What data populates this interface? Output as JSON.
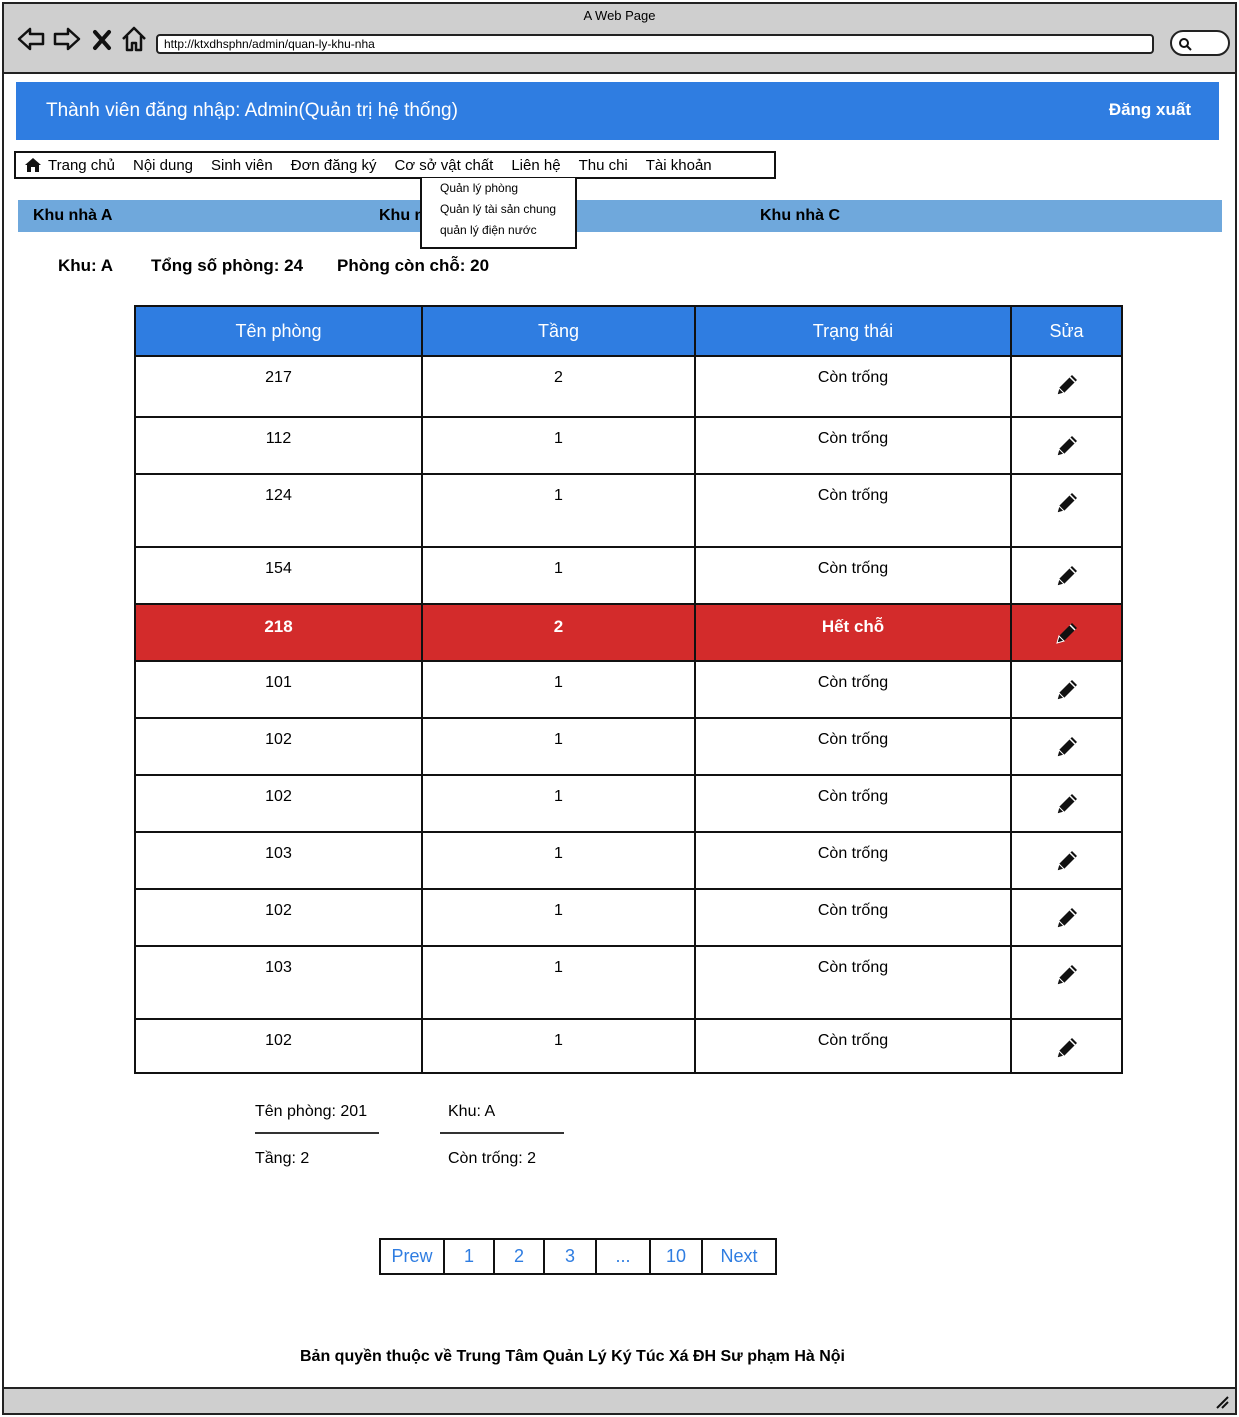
{
  "browser": {
    "window_title": "A Web Page",
    "url": "http://ktxdhsphn/admin/quan-ly-khu-nha"
  },
  "header": {
    "title": "Thành viên đăng nhập: Admin(Quản trị hệ thống)",
    "logout_label": "Đăng xuất"
  },
  "menu": {
    "items": [
      "Trang chủ",
      "Nội dung",
      "Sinh viên",
      "Đơn đăng ký",
      "Cơ sở vật chất",
      "Liên hệ",
      "Thu chi",
      "Tài khoản"
    ],
    "dropdown": [
      "Quản lý phòng",
      "Quản lý tài sản chung",
      "quản lý điện nước"
    ]
  },
  "areas": [
    "Khu nhà A",
    "Khu nhà B",
    "Khu nhà C"
  ],
  "summary": {
    "area": "Khu: A",
    "total_rooms": "Tổng số phòng: 24",
    "rooms_available": "Phòng còn chỗ: 20"
  },
  "table": {
    "headers": [
      "Tên phòng",
      "Tầng",
      "Trạng thái",
      "Sửa"
    ],
    "rows": [
      {
        "room": "217",
        "floor": "2",
        "status": "Còn trống"
      },
      {
        "room": "112",
        "floor": "1",
        "status": "Còn trống"
      },
      {
        "room": "124",
        "floor": "1",
        "status": "Còn trống"
      },
      {
        "room": "154",
        "floor": "1",
        "status": "Còn trống"
      },
      {
        "room": "218",
        "floor": "2",
        "status": "Hết chỗ"
      },
      {
        "room": "101",
        "floor": "1",
        "status": "Còn trống"
      },
      {
        "room": "102",
        "floor": "1",
        "status": "Còn trống"
      },
      {
        "room": "102",
        "floor": "1",
        "status": "Còn trống"
      },
      {
        "room": "103",
        "floor": "1",
        "status": "Còn trống"
      },
      {
        "room": "102",
        "floor": "1",
        "status": "Còn trống"
      },
      {
        "room": "103",
        "floor": "1",
        "status": "Còn trống"
      },
      {
        "room": "102",
        "floor": "1",
        "status": "Còn trống"
      }
    ],
    "full_color": "#d32b2b",
    "header_color": "#2f7de1"
  },
  "detail": {
    "room_name": "Tên phòng: 201",
    "area": "Khu: A",
    "floor": "Tầng:  2",
    "available": "Còn trống: 2"
  },
  "pagination": [
    "Prew",
    "1",
    "2",
    "3",
    "...",
    "10",
    "Next"
  ],
  "footer": "Bản quyền thuộc về Trung Tâm Quản Lý Ký Túc Xá ĐH Sư phạm Hà Nội"
}
